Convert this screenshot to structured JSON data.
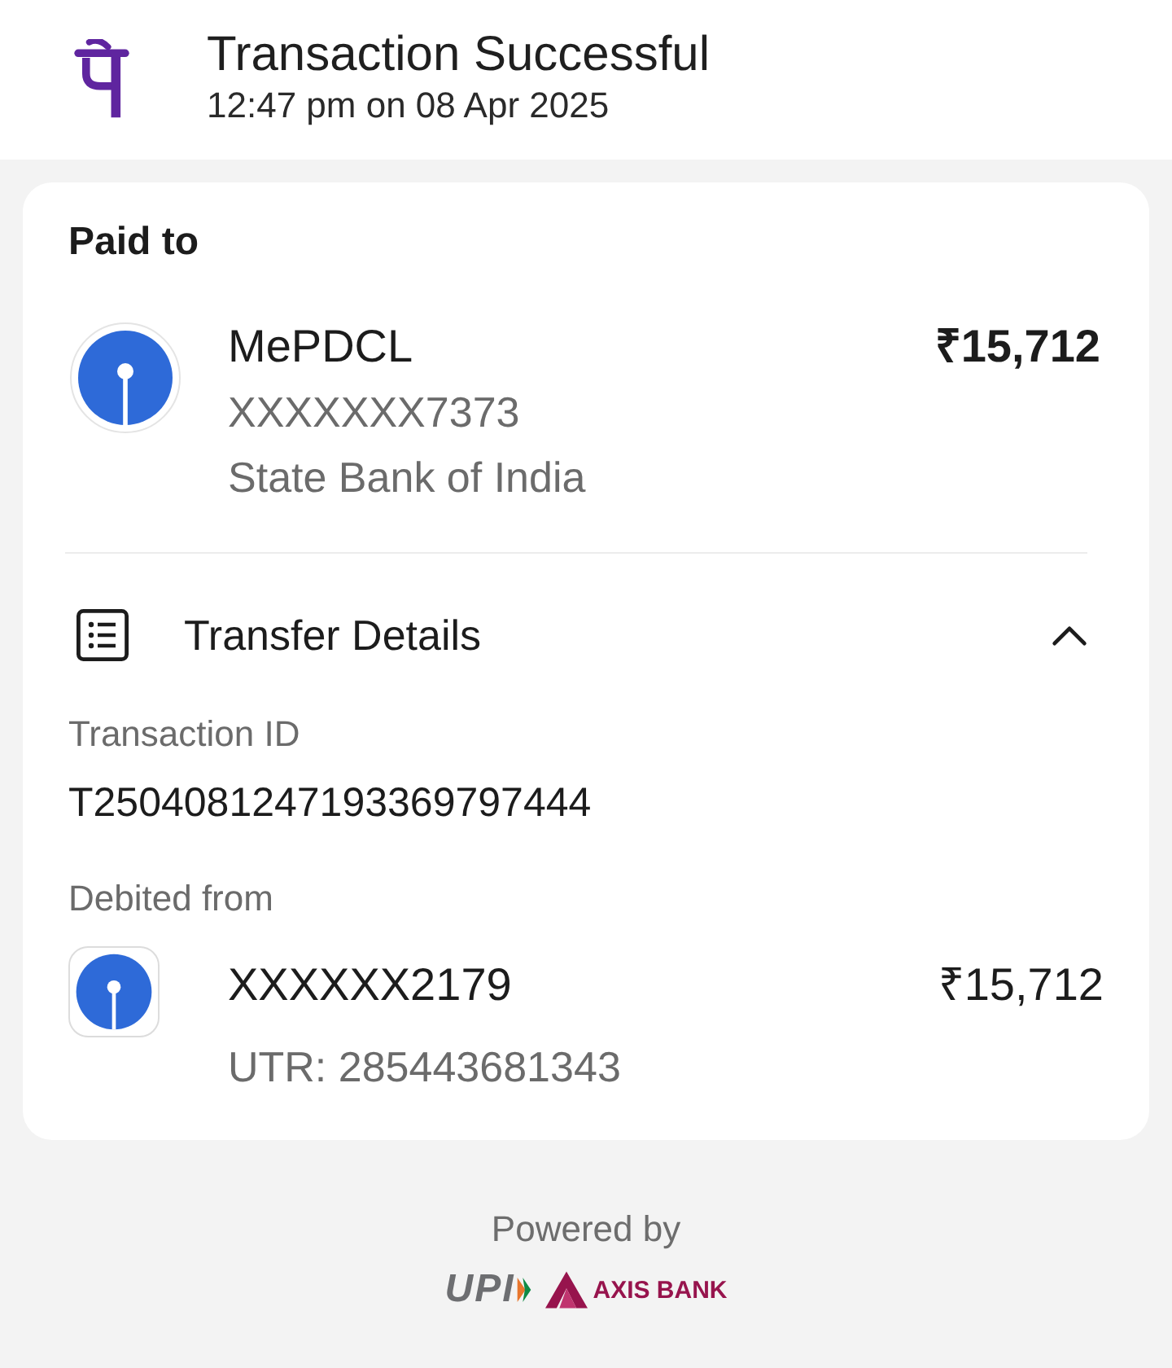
{
  "header": {
    "title": "Transaction Successful",
    "timestamp": "12:47 pm on 08 Apr 2025"
  },
  "paid_to": {
    "heading": "Paid to",
    "name": "MePDCL",
    "account": "XXXXXXX7373",
    "bank": "State Bank of India",
    "amount": "₹15,712"
  },
  "transfer_details": {
    "title": "Transfer Details",
    "expanded": true,
    "fields": [
      {
        "label": "Transaction ID",
        "value": "T2504081247193369797444"
      }
    ],
    "debited_from": {
      "label": "Debited from",
      "account": "XXXXXX2179",
      "amount": "₹15,712",
      "utr": "UTR: 285443681343"
    }
  },
  "footer": {
    "powered_by": "Powered by",
    "logos": [
      {
        "kind": "upi",
        "text": "UPI"
      },
      {
        "kind": "axis",
        "text": "AXIS BANK"
      }
    ]
  }
}
